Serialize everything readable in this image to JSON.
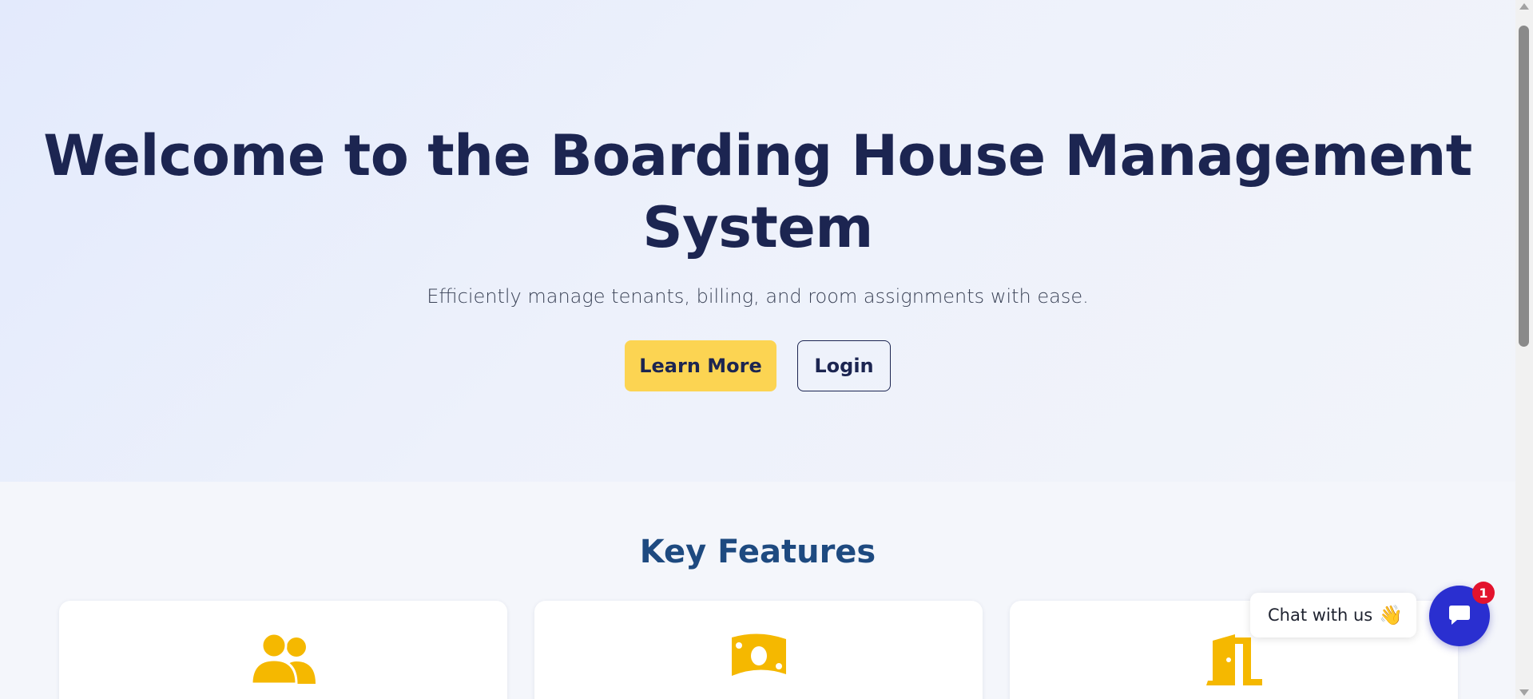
{
  "hero": {
    "title": "Welcome to the Boarding House Management System",
    "subtitle": "Efficiently manage tenants, billing, and room assignments with ease.",
    "learn_more_label": "Learn More",
    "login_label": "Login"
  },
  "features": {
    "title": "Key Features",
    "cards": [
      {
        "icon": "users-icon"
      },
      {
        "icon": "money-bill-icon"
      },
      {
        "icon": "door-open-icon"
      }
    ]
  },
  "chat": {
    "bubble_text": "Chat with us",
    "wave_emoji": "👋",
    "badge_count": "1"
  },
  "colors": {
    "primary_text": "#1c2551",
    "accent_yellow": "#fcd452",
    "features_title": "#1e4a80",
    "chat_button": "#2a2fd0",
    "badge_red": "#e3132d",
    "icon_yellow": "#f5b800"
  }
}
